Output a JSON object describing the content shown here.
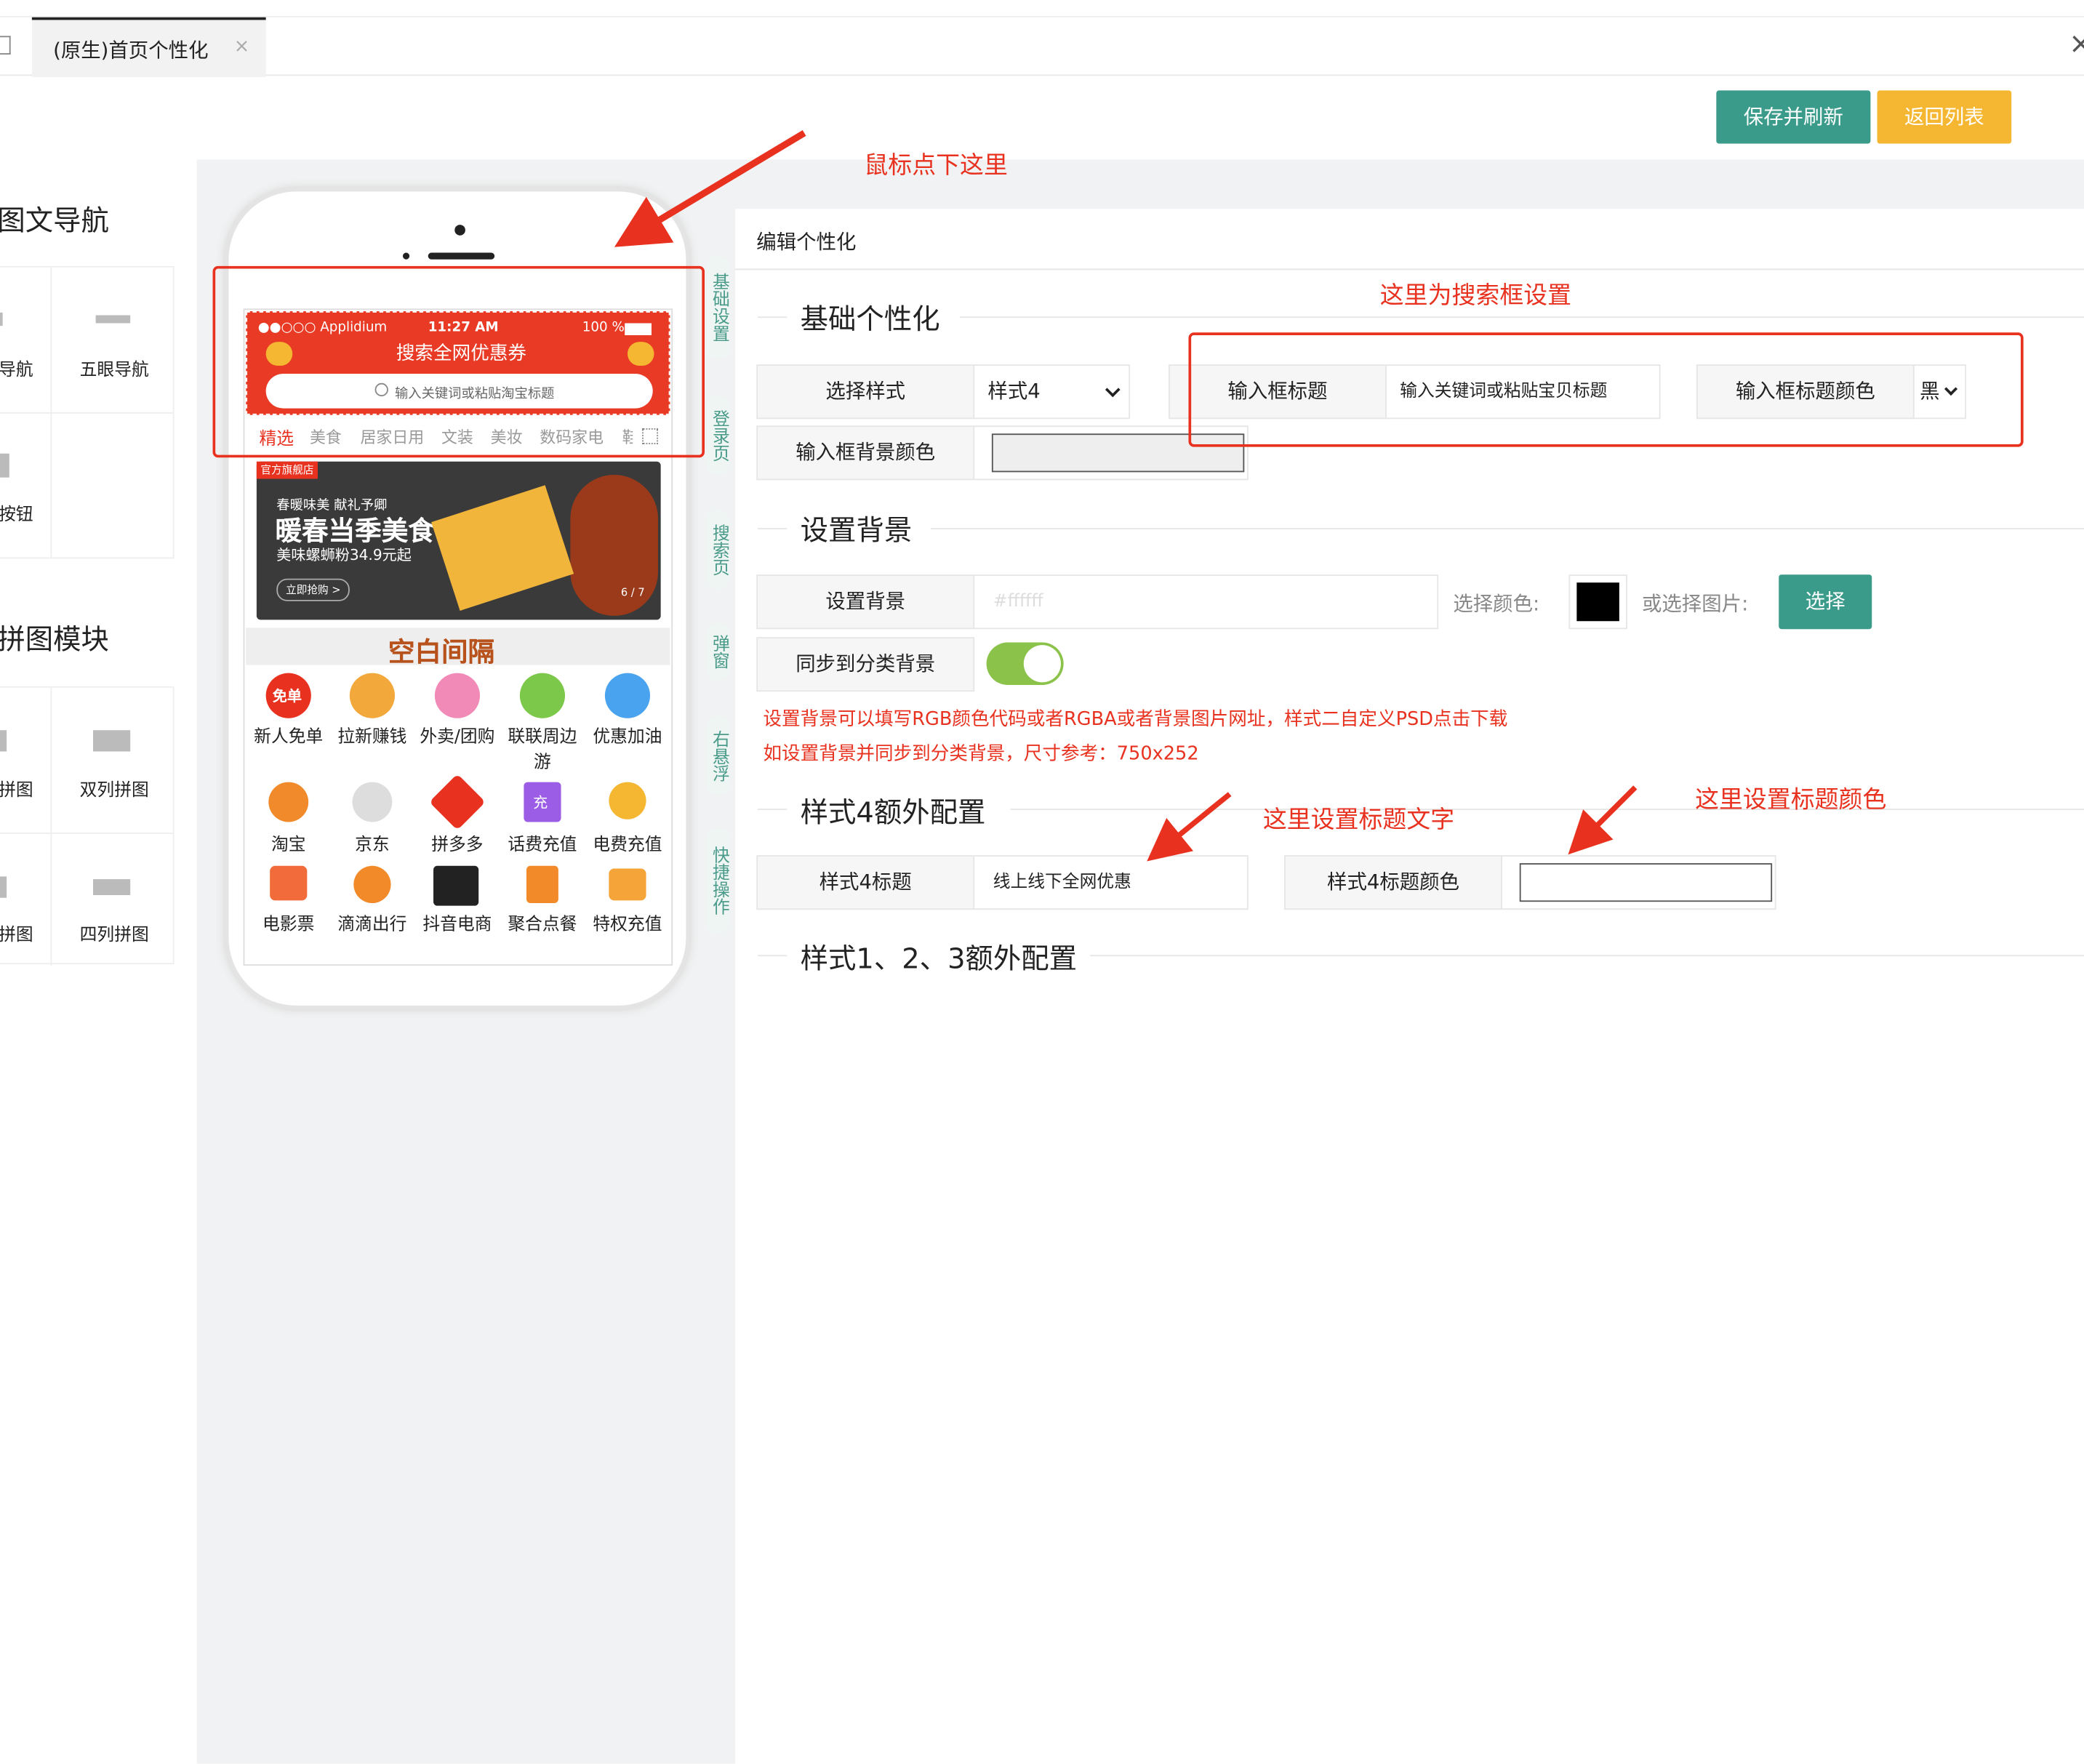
{
  "tabs": {
    "home_icon": "home-icon",
    "active_label": "(原生)首页个性化",
    "close": "×",
    "right_close": "×"
  },
  "toolbar": {
    "save_refresh": "保存并刷新",
    "back_list": "返回列表",
    "save_color": "#3a9b8a",
    "back_color": "#f5b731"
  },
  "left": {
    "nav_title": "图文导航",
    "nav_items": [
      "导航",
      "五眼导航",
      "按钮"
    ],
    "puzzle_title": "拼图模块",
    "puzzle_items": [
      "拼图",
      "双列拼图",
      "拼图",
      "四列拼图"
    ]
  },
  "phone": {
    "carrier": "●●○○○ Applidium",
    "time": "11:27 AM",
    "battery": "100 %",
    "header_title": "搜索全网优惠券",
    "search_placeholder": "输入关键词或粘贴淘宝标题",
    "categories": [
      "精选",
      "美食",
      "居家日用",
      "文装",
      "美妆",
      "数码家电",
      "鞋"
    ],
    "banner": {
      "tag": "官方旗舰店",
      "sub": "春暖味美 献礼予卿",
      "title": "暖春当季美食",
      "price": "美味螺蛳粉34.9元起",
      "cta": "立即抢购 >",
      "page": "6 / 7"
    },
    "spacer_title": "空白间隔",
    "icons_row1": [
      "新人免单",
      "拉新赚钱",
      "外卖/团购",
      "联联周边游",
      "优惠加油"
    ],
    "icons_row2": [
      "淘宝",
      "京东",
      "拼多多",
      "话费充值",
      "电费充值"
    ],
    "icons_row3": [
      "电影票",
      "滴滴出行",
      "抖音电商",
      "聚合点餐",
      "特权充值"
    ],
    "badge_free": "免单",
    "badge_charge": "充"
  },
  "side_tabs": [
    "基础设置",
    "登录页",
    "搜索页",
    "弹窗",
    "右悬浮",
    "快捷操作"
  ],
  "panel": {
    "heading": "编辑个性化",
    "basic": {
      "title": "基础个性化",
      "style_label": "选择样式",
      "style_value": "样式4",
      "input_title_label": "输入框标题",
      "input_title_value": "输入关键词或粘贴宝贝标题",
      "input_title_color_label": "输入框标题颜色",
      "input_title_color_value": "黑",
      "input_bg_label": "输入框背景颜色"
    },
    "bg": {
      "title": "设置背景",
      "label": "设置背景",
      "placeholder": "#ffffff",
      "choose_color": "选择颜色:",
      "or_image": "或选择图片:",
      "choose_btn": "选择",
      "sync_label": "同步到分类背景",
      "note1": "设置背景可以填写RGB颜色代码或者RGBA或者背景图片网址，样式二自定义PSD点击下载",
      "note2": "如设置背景并同步到分类背景，尺寸参考：750x252"
    },
    "style4": {
      "title": "样式4额外配置",
      "title_label": "样式4标题",
      "title_value": "线上线下全网优惠",
      "color_label": "样式4标题颜色"
    },
    "style123": {
      "title": "样式1、2、3额外配置"
    }
  },
  "annotations": {
    "click_here": "鼠标点下这里",
    "search_setting": "这里为搜索框设置",
    "title_text": "这里设置标题文字",
    "title_color": "这里设置标题颜色"
  },
  "colors": {
    "red": "#e8321f",
    "teal": "#3a9b8a",
    "phone_red": "#e83a24"
  }
}
